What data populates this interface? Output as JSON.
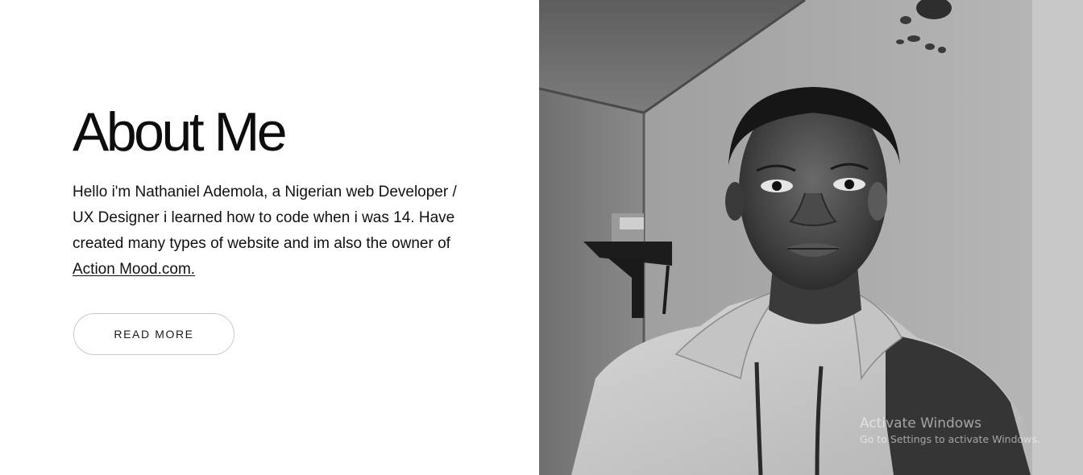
{
  "about": {
    "heading": "About Me",
    "bio_text": "Hello i'm Nathaniel Ademola, a Nigerian web Developer / UX Designer i learned how to code when i was 14. Have created many types of website and im also the owner of ",
    "bio_link_text": "Action Mood.com.",
    "read_more_label": "READ MORE"
  },
  "photo": {
    "icon": "profile-photo",
    "tone": "grayscale"
  },
  "watermark": {
    "title": "Activate Windows",
    "subtitle": "Go to Settings to activate Windows."
  }
}
